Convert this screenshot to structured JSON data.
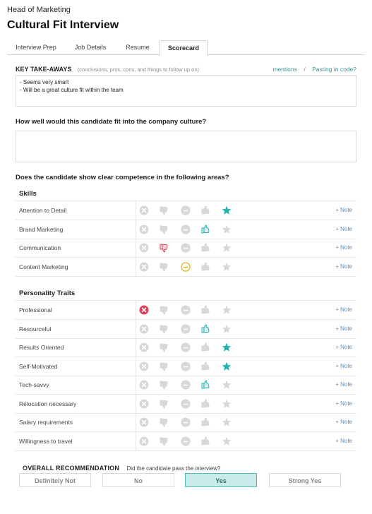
{
  "header": {
    "subtitle": "Head of Marketing",
    "title": "Cultural Fit Interview"
  },
  "tabs": [
    {
      "label": "Interview Prep",
      "active": false
    },
    {
      "label": "Job Details",
      "active": false
    },
    {
      "label": "Resume",
      "active": false
    },
    {
      "label": "Scorecard",
      "active": true
    }
  ],
  "takeaways": {
    "label": "KEY TAKE-AWAYS",
    "hint": "(conclusions, pros, cons, and things to follow up on)",
    "mentions_link": "mentions",
    "separator": "/",
    "code_link": "Pasting in code?",
    "lines": [
      "- Seems very smart",
      "- Will be a great culture fit within the team"
    ]
  },
  "culture_question": {
    "text": "How well would this candidate fit into the company culture?",
    "value": ""
  },
  "competence_question": "Does the candidate show clear competence in the following areas?",
  "note_label": "+ Note",
  "colors": {
    "accent": "#23b5b0",
    "negative": "#e0435a",
    "neutral": "#e6b21f",
    "inactive": "#d8d8d8"
  },
  "groups": [
    {
      "title": "Skills",
      "items": [
        {
          "label": "Attention to Detail",
          "rating": "strong_yes"
        },
        {
          "label": "Brand Marketing",
          "rating": "yes"
        },
        {
          "label": "Communication",
          "rating": "no"
        },
        {
          "label": "Content Marketing",
          "rating": "neutral"
        }
      ]
    },
    {
      "title": "Personality Traits",
      "items": [
        {
          "label": "Professional",
          "rating": "strong_no"
        },
        {
          "label": "Resourceful",
          "rating": "yes"
        },
        {
          "label": "Results Oriented",
          "rating": "strong_yes"
        },
        {
          "label": "Self-Motivated",
          "rating": "strong_yes"
        },
        {
          "label": "Tech-savvy",
          "rating": "yes"
        },
        {
          "label": "Relocation necessary",
          "rating": "none"
        },
        {
          "label": "Salary requirements",
          "rating": "none"
        },
        {
          "label": "Willingness to travel",
          "rating": "none"
        }
      ]
    }
  ],
  "recommendation": {
    "label": "OVERALL RECOMMENDATION",
    "question": "Did the candidate pass the interview?",
    "options": [
      {
        "label": "Definitely Not",
        "selected": false
      },
      {
        "label": "No",
        "selected": false
      },
      {
        "label": "Yes",
        "selected": true
      },
      {
        "label": "Strong Yes",
        "selected": false
      }
    ]
  }
}
